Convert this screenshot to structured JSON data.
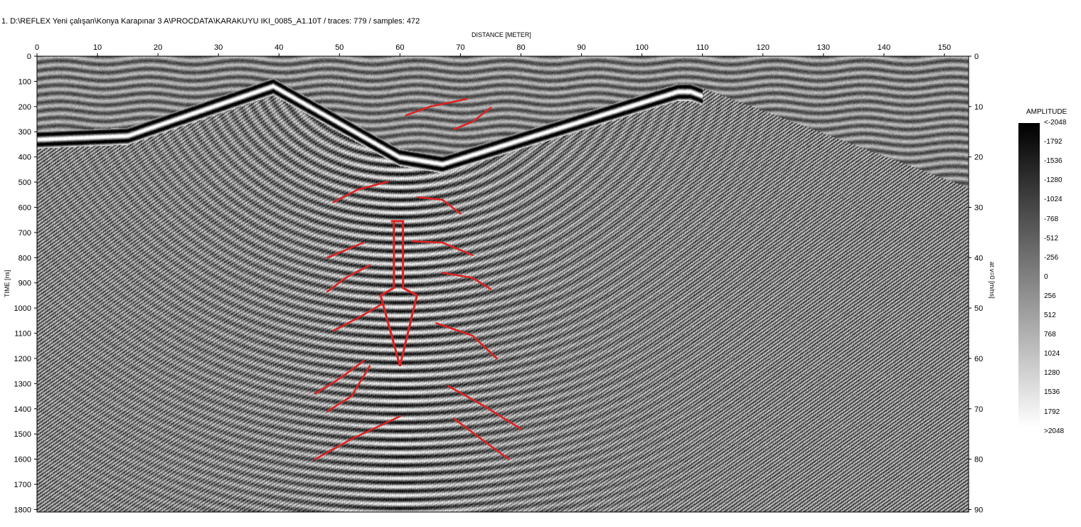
{
  "window": {
    "title": "1. D:\\REFLEX Yeni çalışan\\Konya Karapınar 3 A\\PROCDATA\\KARAKUYU IKI_0085_A1.10T  / traces: 779 / samples: 472"
  },
  "plot": {
    "xlabel": "DISTANCE [METER]",
    "ylabel": "TIME [ns]",
    "ylabel_right": "at v=0 [m/ns]",
    "x_ticks": [
      "0",
      "10",
      "20",
      "30",
      "40",
      "50",
      "60",
      "70",
      "80",
      "90",
      "100",
      "110",
      "120",
      "130",
      "140",
      "150"
    ],
    "y_ticks": [
      "0",
      "100",
      "200",
      "300",
      "400",
      "500",
      "600",
      "700",
      "800",
      "900",
      "1000",
      "1100",
      "1200",
      "1300",
      "1400",
      "1500",
      "1600",
      "1700",
      "1800"
    ],
    "y2_ticks": [
      "0",
      "10",
      "20",
      "30",
      "40",
      "50",
      "60",
      "70",
      "80",
      "90"
    ],
    "xlim": [
      0,
      154
    ],
    "ylim": [
      0,
      1810
    ],
    "y2lim": [
      0,
      90.5
    ]
  },
  "legend": {
    "title": "AMPLITUDE",
    "labels": [
      "<-2048",
      "-1792",
      "-1536",
      "-1280",
      "-1024",
      "-768",
      "-512",
      "-256",
      "0",
      "256",
      "512",
      "768",
      "1024",
      "1280",
      "1536",
      "1792",
      ">2048"
    ],
    "color_low": "#000000",
    "color_high": "#ffffff"
  },
  "annotations": {
    "color": "#e02020",
    "shape": "down-arrow with hyperbola tracing lines"
  }
}
